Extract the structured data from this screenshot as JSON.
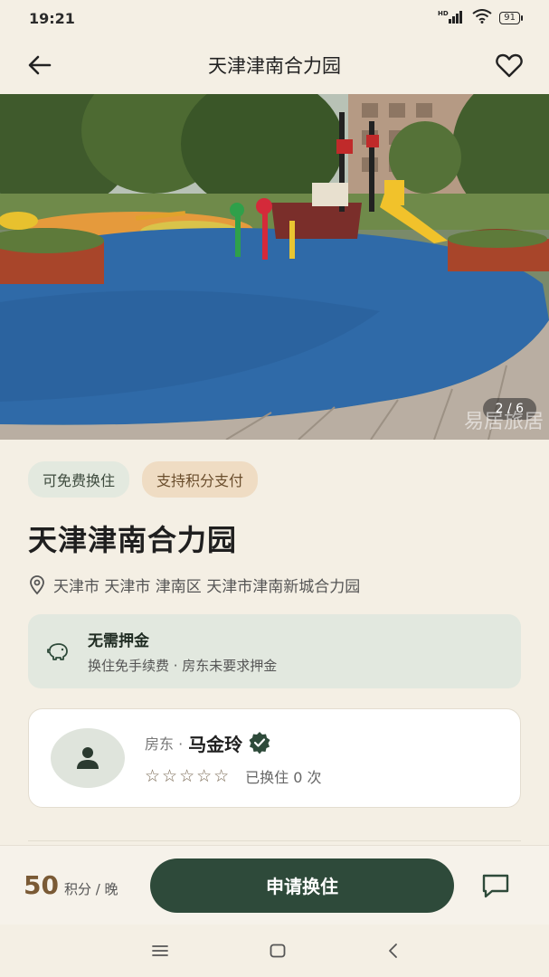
{
  "status": {
    "time": "19:21",
    "hd": "HD",
    "battery": "91"
  },
  "header": {
    "title": "天津津南合力园",
    "back_icon": "arrow-left-icon",
    "fav_icon": "heart-outline-icon"
  },
  "gallery": {
    "counter": "2 / 6",
    "watermark": "易居旅居"
  },
  "tags": [
    {
      "label": "可免费换住",
      "color": "#e3e9df"
    },
    {
      "label": "支持积分支付",
      "color": "#efdcc3"
    }
  ],
  "listing": {
    "title": "天津津南合力园",
    "address": "天津市 天津市 津南区 天津市津南新城合力园"
  },
  "deposit": {
    "title": "无需押金",
    "subtitle": "换住免手续费 · 房东未要求押金"
  },
  "host": {
    "role": "房东 ·",
    "name": "马金玲",
    "stars": "☆☆☆☆☆",
    "swap_count": "已换住 0 次"
  },
  "footer": {
    "price": "50",
    "unit": "积分 / 晚",
    "apply_label": "申请换住",
    "accent": "#2e4a3a"
  }
}
